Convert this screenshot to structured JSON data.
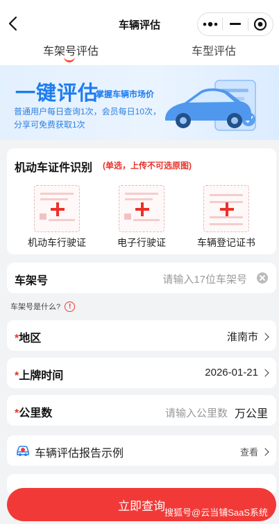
{
  "header": {
    "title": "车辆评估"
  },
  "tabs": [
    {
      "label": "车架号评估",
      "active": true
    },
    {
      "label": "车型评估",
      "active": false
    }
  ],
  "banner": {
    "title": "一键评估",
    "subtitle": "掌握车辆市场价",
    "line1": "普通用户每日查询1次，会员每日10次，",
    "line2": "分享可免费获取1次"
  },
  "upload": {
    "title": "机动车证件识别",
    "note": "(单选，上传不可选原图)",
    "docs": [
      {
        "label": "机动车行驶证"
      },
      {
        "label": "电子行驶证"
      },
      {
        "label": "车辆登记证书"
      }
    ]
  },
  "vin": {
    "label": "车架号",
    "placeholder": "请输入17位车架号"
  },
  "vin_hint": {
    "text": "车架号是什么?",
    "icon": "!"
  },
  "region": {
    "required": "*",
    "label": "地区",
    "value": "淮南市"
  },
  "plate_date": {
    "required": "*",
    "label": "上牌时间",
    "value": "2026-01-21"
  },
  "mileage": {
    "required": "*",
    "label": "公里数",
    "placeholder": "请输入公里数",
    "unit": "万公里"
  },
  "report": {
    "label": "车辆评估报告示例",
    "link": "查看"
  },
  "submit": {
    "label": "立即查询"
  },
  "watermark": "搜狐号@云当铺SaaS系统",
  "colors": {
    "accent": "#f13a37",
    "brand_blue": "#1c7cf0",
    "required": "#e8322b"
  }
}
